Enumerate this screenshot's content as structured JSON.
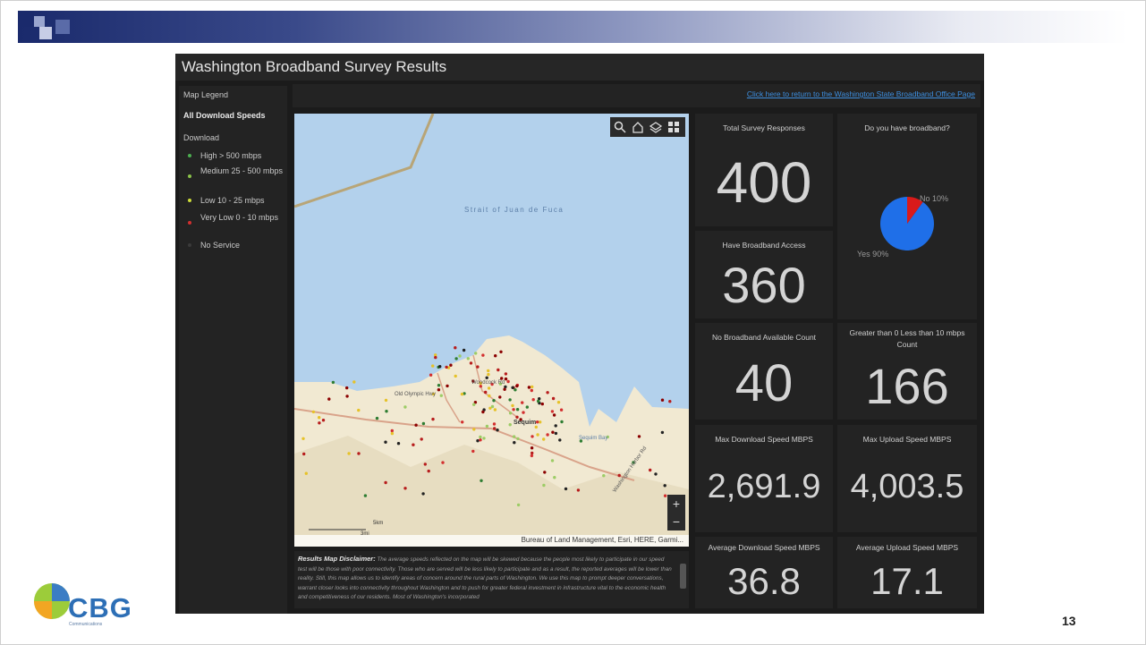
{
  "slide": {
    "page_number": "13",
    "logo_text": "CBG",
    "logo_sub": "Communications"
  },
  "dashboard": {
    "title": "Washington Broadband Survey Results",
    "link_text": "Click here to return to the Washington State Broadband Office Page",
    "legend": {
      "heading": "Map Legend",
      "layer": "All Download Speeds",
      "group": "Download",
      "items": [
        {
          "label": "High > 500 mbps",
          "color": "#4caf50"
        },
        {
          "label": "Medium 25 - 500 mbps",
          "color": "#8bc34a"
        },
        {
          "label": "Low 10 - 25 mbps",
          "color": "#cddc39"
        },
        {
          "label": "Very Low 0 - 10 mbps",
          "color": "#d32f2f"
        },
        {
          "label": "No Service",
          "color": "#222222"
        }
      ]
    },
    "map": {
      "water_label": "Strait of Juan de Fuca",
      "place_labels": [
        "Sequim",
        "Old Olympic Hwy",
        "Woodcock Rd",
        "Sequim Bay",
        "Washington Harbor Rd"
      ],
      "attribution": "Bureau of Land Management, Esri, HERE, Garmi...",
      "scale_labels": [
        "5km",
        "3mi"
      ],
      "tools": [
        "search-icon",
        "home-icon",
        "layers-icon",
        "basemap-gallery-icon"
      ],
      "zoom_in": "+",
      "zoom_out": "−"
    },
    "disclaimer": {
      "heading": "Results Map Disclaimer:",
      "text": "The average speeds reflected on the map will be skewed because the people most likely to participate in our speed test will be those with poor connectivity. Those who are served will be less likely to participate and as a result, the reported averages will be lower than reality. Still, this map allows us to identify areas of concern around the rural parts of Washington. We use this map to prompt deeper conversations, warrant closer looks into connectivity throughout Washington and to push for greater federal investment in infrastructure vital to the economic health and competitiveness of our residents. Most of Washington's incorporated"
    },
    "cards": {
      "total_responses": {
        "title": "Total Survey Responses",
        "value": "400"
      },
      "have_access": {
        "title": "Have Broadband Access",
        "value": "360"
      },
      "no_broadband": {
        "title": "No Broadband Available Count",
        "value": "40"
      },
      "slow_count": {
        "title": "Greater than 0 Less than 10 mbps Count",
        "value": "166"
      },
      "max_download": {
        "title": "Max Download Speed MBPS",
        "value": "2,691.9"
      },
      "max_upload": {
        "title": "Max Upload Speed MBPS",
        "value": "4,003.5"
      },
      "avg_download": {
        "title": "Average Download Speed MBPS",
        "value": "36.8"
      },
      "avg_upload": {
        "title": "Average Upload Speed MBPS",
        "value": "17.1"
      }
    },
    "broadband_pie": {
      "title": "Do you have broadband?",
      "yes_label": "Yes 90%",
      "no_label": "No 10%"
    }
  },
  "chart_data": {
    "type": "pie",
    "title": "Do you have broadband?",
    "categories": [
      "Yes",
      "No"
    ],
    "values": [
      90,
      10
    ],
    "colors": [
      "#1f6fe8",
      "#d91a1a"
    ]
  }
}
